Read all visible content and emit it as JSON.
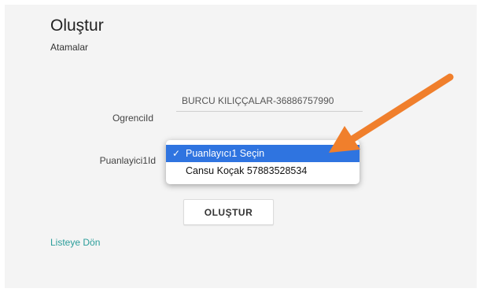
{
  "page": {
    "title": "Oluştur",
    "subtitle": "Atamalar"
  },
  "form": {
    "ogrenci_label": "OgrenciId",
    "ogrenci_value": "BURCU KILIÇÇALAR-36886757990",
    "puanlayici_label": "Puanlayici1Id",
    "puanlayici_options": [
      {
        "label": "Puanlayıcı1 Seçin",
        "selected": true
      },
      {
        "label": "Cansu Koçak 57883528534",
        "selected": false
      }
    ],
    "submit_label": "OLUŞTUR"
  },
  "links": {
    "back_label": "Listeye Dön"
  },
  "colors": {
    "selected_option": "#2f74e0",
    "link": "#2a9d9a",
    "annotation_arrow": "#f07f2c"
  },
  "icons": {
    "check": "check-icon",
    "arrow": "annotation-arrow-icon"
  }
}
